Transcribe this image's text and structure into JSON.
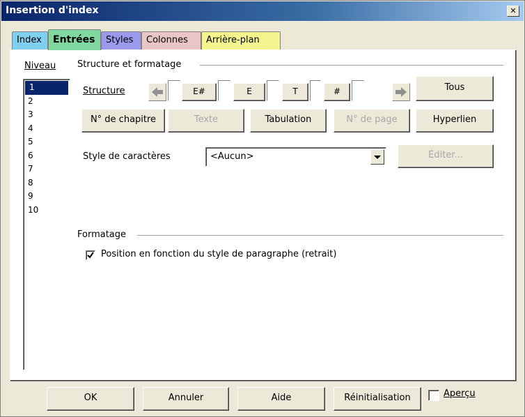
{
  "window": {
    "title": "Insertion d'index",
    "close_glyph": "✕"
  },
  "tabs": [
    {
      "label": "Index",
      "color": "#7ed0ee"
    },
    {
      "label": "Entrées",
      "color": "#80d8a0"
    },
    {
      "label": "Styles",
      "color": "#9a9aec"
    },
    {
      "label": "Colonnes",
      "color": "#e9c5c5"
    },
    {
      "label": "Arrière-plan",
      "color": "#f5f590"
    }
  ],
  "level": {
    "heading": "Niveau",
    "items": [
      "1",
      "2",
      "3",
      "4",
      "5",
      "6",
      "7",
      "8",
      "9",
      "10"
    ],
    "selected": "1"
  },
  "structure_group": {
    "heading": "Structure et formatage",
    "structure_label": "Structure",
    "tokens": [
      "E#",
      "E",
      "T",
      "#"
    ],
    "all_button": "Tous",
    "buttons": {
      "chapter_no": "N° de chapitre",
      "text": "Texte",
      "tab": "Tabulation",
      "page_no": "N° de page",
      "hyperlink": "Hyperlien"
    },
    "char_style_label": "Style de caractères",
    "char_style_value": "<Aucun>",
    "edit_button": "Éditer..."
  },
  "formatting_group": {
    "heading": "Formatage",
    "checkbox_label": "Position en fonction du style de paragraphe (retrait)",
    "checkbox_checked": true
  },
  "footer": {
    "ok": "OK",
    "cancel": "Annuler",
    "help": "Aide",
    "reset": "Réinitialisation",
    "preview": "Aperçu",
    "preview_checked": false
  }
}
